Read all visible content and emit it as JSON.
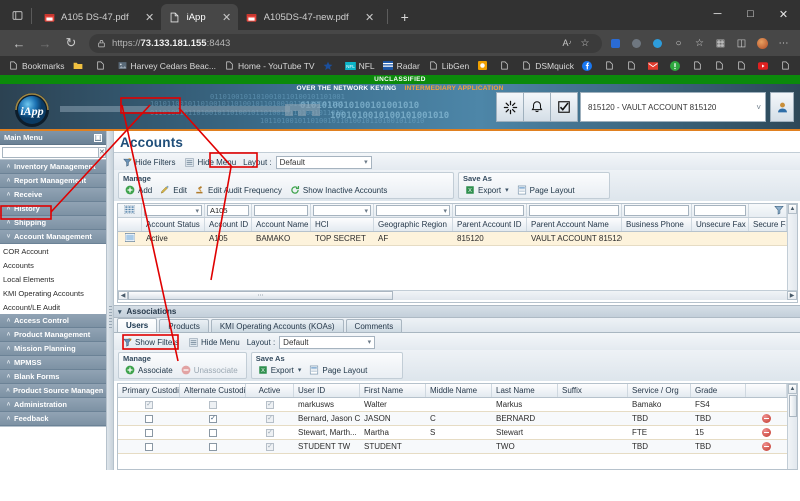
{
  "browser": {
    "tabs": [
      {
        "title": "A105 DS-47.pdf",
        "icon": "pdf-icon",
        "active": false
      },
      {
        "title": "iApp",
        "icon": "page-icon",
        "active": true
      },
      {
        "title": "A105DS-47-new.pdf",
        "icon": "pdf-icon",
        "active": false
      }
    ],
    "new_tab_label": "+",
    "window_controls": {
      "minimize": "─",
      "maximize": "□",
      "close": "✕"
    },
    "nav": {
      "back": "←",
      "forward": "→",
      "reload": "↻"
    },
    "address": {
      "scheme": "https://",
      "host": "73.133.181.155",
      "port": ":8443",
      "lock": "lock-icon"
    },
    "omnibox_actions": [
      "read-aloud-icon",
      "add-favorite-icon"
    ],
    "toolbar_icons": [
      "collections-icon",
      "analytics-icon",
      "shopping-icon",
      "browser-essentials-icon",
      "favorites-icon",
      "tab-actions-icon",
      "split-screen-icon",
      "profile-avatar",
      "settings-more-icon"
    ],
    "bookmarks": [
      {
        "label": "Bookmarks",
        "icon": "page-icon"
      },
      {
        "label": "",
        "icon": "folder-icon"
      },
      {
        "label": "",
        "icon": "page-icon"
      },
      {
        "label": "Harvey Cedars Beac...",
        "icon": "photo-icon"
      },
      {
        "label": "Home - YouTube TV",
        "icon": "page-icon"
      },
      {
        "label": "",
        "icon": "star-icon"
      },
      {
        "label": "NFL",
        "icon": "nfl-icon"
      },
      {
        "label": "Radar",
        "icon": "radar-icon"
      },
      {
        "label": "LibGen",
        "icon": "page-icon"
      },
      {
        "label": "",
        "icon": "orange-square-icon"
      },
      {
        "label": "",
        "icon": "page-icon"
      },
      {
        "label": "DSMquick",
        "icon": "page-icon"
      },
      {
        "label": "",
        "icon": "facebook-icon"
      },
      {
        "label": "",
        "icon": "page-icon"
      },
      {
        "label": "",
        "icon": "page-icon"
      },
      {
        "label": "",
        "icon": "gmail-icon"
      },
      {
        "label": "",
        "icon": "alert-icon"
      },
      {
        "label": "",
        "icon": "page-icon"
      },
      {
        "label": "",
        "icon": "page-icon"
      },
      {
        "label": "",
        "icon": "page-icon"
      },
      {
        "label": "",
        "icon": "youtube-icon"
      },
      {
        "label": "",
        "icon": "page-icon"
      }
    ],
    "bookmarks_overflow": "›"
  },
  "app": {
    "classification": "UNCLASSIFIED",
    "banner_white": "OVER THE NETWORK KEYING",
    "banner_orange": "INTERMEDIARY APPLICATION",
    "logo_text": "iApp",
    "header_buttons": [
      "refresh-icon",
      "notification-bell-icon",
      "tasks-checkbox-icon"
    ],
    "account_selector": {
      "value": "815120 - VAULT ACCOUNT 815120",
      "caret": "˅"
    },
    "user_button": "user-profile-icon"
  },
  "sidebar": {
    "title": "Main Menu",
    "pin": "▣",
    "search_value": "",
    "search_placeholder": "",
    "clear_label": "✕",
    "groups": [
      {
        "label": "Inventory Management",
        "expanded": false
      },
      {
        "label": "Report Management",
        "expanded": false
      },
      {
        "label": "Receive",
        "expanded": false
      },
      {
        "label": "History",
        "expanded": false
      },
      {
        "label": "Shipping",
        "expanded": false
      },
      {
        "label": "Account Management",
        "expanded": true,
        "items": [
          "COR Account",
          "Accounts",
          "Local Elements",
          "KMI Operating Accounts",
          "Account/LE Audit"
        ]
      },
      {
        "label": "Access Control",
        "expanded": false
      },
      {
        "label": "Product Management",
        "expanded": false
      },
      {
        "label": "Mission Planning",
        "expanded": false
      },
      {
        "label": "MPMSS",
        "expanded": false
      },
      {
        "label": "Blank Forms",
        "expanded": false
      },
      {
        "label": "Product Source Managem...",
        "expanded": false
      },
      {
        "label": "Administration",
        "expanded": false
      },
      {
        "label": "Feedback",
        "expanded": false
      }
    ],
    "collapse_arrow": "˄",
    "expand_arrow": "˅"
  },
  "main": {
    "page_title": "Accounts",
    "toolbar": {
      "hide_filters": "Hide Filters",
      "hide_menu": "Hide Menu",
      "layout_label": "Layout :",
      "layout_value": "Default"
    },
    "ribbon": {
      "manage_label": "Manage",
      "manage_items": [
        "Add",
        "Edit",
        "Edit Audit Frequency",
        "Show Inactive Accounts"
      ],
      "saveas_label": "Save As",
      "saveas_items": [
        "Export",
        "Page Layout"
      ],
      "export_caret": "▾"
    },
    "grid": {
      "columns": [
        "Account Status",
        "Account ID",
        "Account Name",
        "HCI",
        "Geographic Region",
        "Parent Account ID",
        "Parent Account Name",
        "Business Phone",
        "Unsecure Fax",
        "Secure Fax"
      ],
      "filters": [
        "",
        "A105",
        "",
        "",
        "",
        "",
        "",
        "",
        "",
        ""
      ],
      "filter_icon": "filter-icon",
      "rows": [
        {
          "Account Status": "Active",
          "Account ID": "A105",
          "Account Name": "BAMAKO",
          "HCI": "TOP SECRET",
          "Geographic Region": "AF",
          "Parent Account ID": "815120",
          "Parent Account Name": "VAULT ACCOUNT 815120",
          "Business Phone": "",
          "Unsecure Fax": "",
          "Secure Fax": ""
        }
      ],
      "hscroll_thumb": "⋯"
    }
  },
  "associations": {
    "section_title": "Associations",
    "tabs": [
      {
        "label": "Users",
        "selected": true
      },
      {
        "label": "Products",
        "selected": false
      },
      {
        "label": "KMI Operating Accounts (KOAs)",
        "selected": false
      },
      {
        "label": "Comments",
        "selected": false
      }
    ],
    "toolbar": {
      "show_filters": "Show Filters",
      "hide_menu": "Hide Menu",
      "layout_label": "Layout :",
      "layout_value": "Default"
    },
    "ribbon": {
      "manage_label": "Manage",
      "associate": "Associate",
      "unassociate": "Unassociate",
      "saveas_label": "Save As",
      "export": "Export",
      "page_layout": "Page Layout",
      "export_caret": "▾"
    },
    "grid": {
      "columns": [
        "Primary Custodian",
        "Alternate Custodian",
        "Active",
        "User ID",
        "First Name",
        "Middle Name",
        "Last Name",
        "Suffix",
        "Service / Org",
        "Grade"
      ],
      "rows": [
        {
          "primary": true,
          "primary_disabled": true,
          "alternate": false,
          "alternate_disabled": true,
          "active": true,
          "User ID": "markusws",
          "First Name": "Walter",
          "Middle Name": "",
          "Last Name": "Markus",
          "Suffix": "",
          "Service / Org": "Bamako",
          "Grade": "FS4",
          "remove": false
        },
        {
          "primary": false,
          "primary_disabled": false,
          "alternate": true,
          "alternate_disabled": false,
          "active": true,
          "User ID": "Bernard, Jason C",
          "First Name": "JASON",
          "Middle Name": "C",
          "Last Name": "BERNARD",
          "Suffix": "",
          "Service / Org": "TBD",
          "Grade": "TBD",
          "remove": true
        },
        {
          "primary": false,
          "primary_disabled": false,
          "alternate": false,
          "alternate_disabled": false,
          "active": true,
          "User ID": "Stewart, Marth...",
          "First Name": "Martha",
          "Middle Name": "S",
          "Last Name": "Stewart",
          "Suffix": "",
          "Service / Org": "FTE",
          "Grade": "15",
          "remove": true
        },
        {
          "primary": false,
          "primary_disabled": false,
          "alternate": false,
          "alternate_disabled": false,
          "active": true,
          "User ID": "STUDENT TW",
          "First Name": "STUDENT",
          "Middle Name": "",
          "Last Name": "TWO",
          "Suffix": "",
          "Service / Org": "TBD",
          "Grade": "TBD",
          "remove": true
        }
      ]
    }
  },
  "annotation": {
    "color": "#e00000",
    "highlights": [
      "sidebar-accounts-item",
      "hide-filters-button",
      "account-id-filter-input",
      "associate-button"
    ]
  }
}
